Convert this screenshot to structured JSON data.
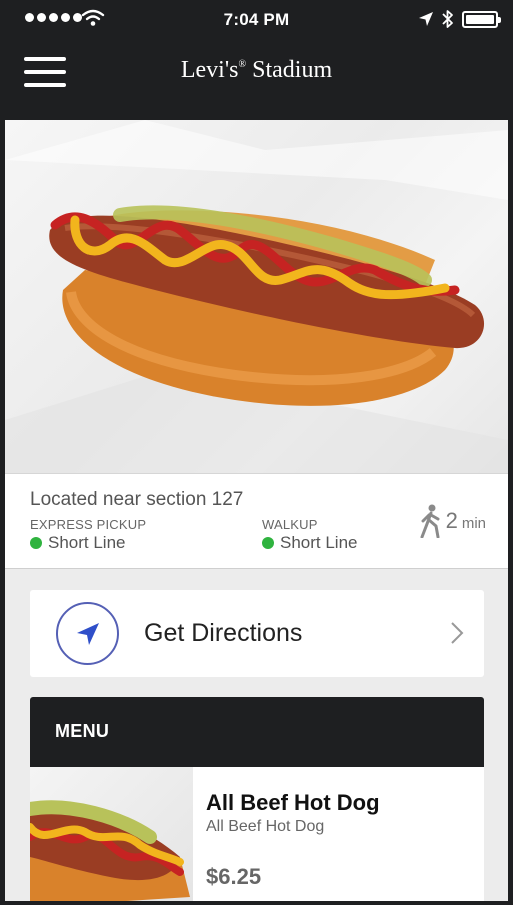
{
  "status": {
    "time": "7:04 PM"
  },
  "header": {
    "title": "Levi's",
    "title_mark": "®",
    "title_suffix": " Stadium"
  },
  "venue": {
    "location": "Located near section 127",
    "express_label": "EXPRESS PICKUP",
    "express_status": "Short Line",
    "walkup_label": "WALKUP",
    "walkup_status": "Short Line",
    "status_color": "#2fb33f",
    "walk_time": "2",
    "walk_unit": "min"
  },
  "directions": {
    "label": "Get Directions",
    "accent": "#5560b5"
  },
  "menu": {
    "header": "MENU",
    "items": [
      {
        "name": "All Beef Hot Dog",
        "description": "All Beef Hot Dog",
        "price": "$6.25"
      }
    ]
  }
}
